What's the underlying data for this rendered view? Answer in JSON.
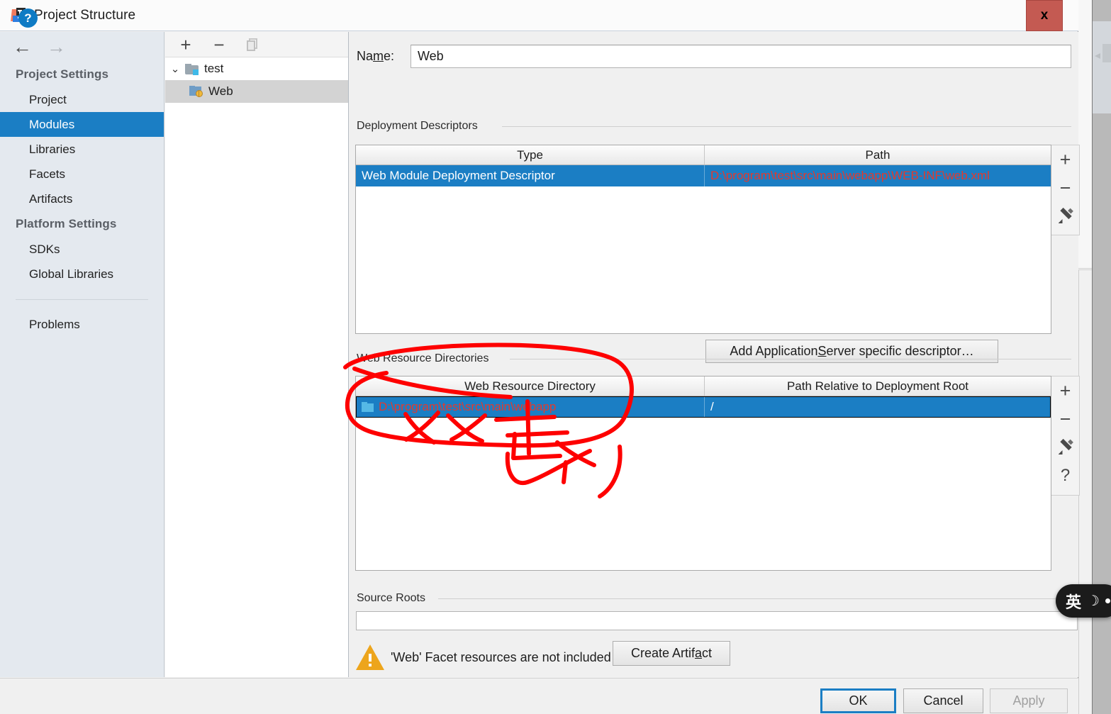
{
  "window": {
    "title": "Project Structure",
    "app_icon": "intellij-idea-icon",
    "close_label": "x"
  },
  "nav": {
    "back_icon": "arrow-left-icon",
    "forward_icon": "arrow-right-icon"
  },
  "sidebar": {
    "groups": [
      {
        "title": "Project Settings",
        "items": [
          {
            "label": "Project",
            "selected": false
          },
          {
            "label": "Modules",
            "selected": true
          },
          {
            "label": "Libraries",
            "selected": false
          },
          {
            "label": "Facets",
            "selected": false
          },
          {
            "label": "Artifacts",
            "selected": false
          }
        ]
      },
      {
        "title": "Platform Settings",
        "items": [
          {
            "label": "SDKs",
            "selected": false
          },
          {
            "label": "Global Libraries",
            "selected": false
          }
        ]
      }
    ],
    "problems_label": "Problems"
  },
  "tree": {
    "toolbar": {
      "add_icon": "plus-icon",
      "remove_icon": "minus-icon",
      "copy_icon": "copy-icon"
    },
    "nodes": [
      {
        "label": "test",
        "icon": "module-folder-icon",
        "expanded": true,
        "selected": false,
        "chevron": "⌄"
      },
      {
        "label": "Web",
        "icon": "web-facet-icon",
        "expanded": false,
        "selected": true,
        "chevron": ""
      }
    ]
  },
  "main": {
    "name_field": {
      "label_before": "Na",
      "label_mnemonic": "m",
      "label_after": "e:",
      "value": "Web"
    },
    "deployment_descriptors": {
      "caption": "Deployment Descriptors",
      "columns": [
        "Type",
        "Path"
      ],
      "rows": [
        {
          "type": "Web Module Deployment Descriptor",
          "path": "D:\\program\\test\\src\\main\\webapp\\WEB-INF\\web.xml",
          "selected": true,
          "path_error": true
        }
      ],
      "toolbar": [
        "plus-icon",
        "minus-icon",
        "pencil-icon"
      ]
    },
    "add_descriptor_button": {
      "before": "Add Application ",
      "mnemonic": "S",
      "after": "erver specific descriptor…"
    },
    "web_resource_directories": {
      "caption": "Web Resource Directories",
      "columns": [
        "Web Resource Directory",
        "Path Relative to Deployment Root"
      ],
      "rows": [
        {
          "directory": "D:\\program\\test\\src\\main\\webapp",
          "relative_path": "/",
          "selected": true,
          "directory_error": true
        }
      ],
      "toolbar": [
        "plus-icon",
        "minus-icon",
        "pencil-icon",
        "question-icon"
      ]
    },
    "source_roots": {
      "caption": "Source Roots",
      "value": ""
    },
    "warning": {
      "icon": "warning-triangle-icon",
      "text": "'Web' Facet resources are not included in an artifact"
    },
    "create_artifact_button": {
      "before": "Create Artif",
      "mnemonic": "a",
      "after": "ct"
    }
  },
  "footer": {
    "help_label": "?",
    "buttons": [
      {
        "label": "OK",
        "style": "default",
        "enabled": true
      },
      {
        "label": "Cancel",
        "style": "normal",
        "enabled": true
      },
      {
        "label": "Apply",
        "style": "disabled",
        "enabled": false
      }
    ]
  },
  "ime_widget": {
    "language": "英",
    "moon_icon": "☽"
  },
  "annotation": {
    "color": "#fe0000",
    "description": "hand-drawn red circle around the Web Resource Directory row with handwritten chinese characters meaning double-click"
  },
  "colors": {
    "selection_blue": "#1b7ec4",
    "error_red": "#e23a2e",
    "warning_orange": "#eda51c",
    "annotation_red": "#fe0000",
    "close_button_red": "#c45a52",
    "sidebar_bg": "#e4e9ef",
    "dialog_bg": "#f0f0f0"
  }
}
